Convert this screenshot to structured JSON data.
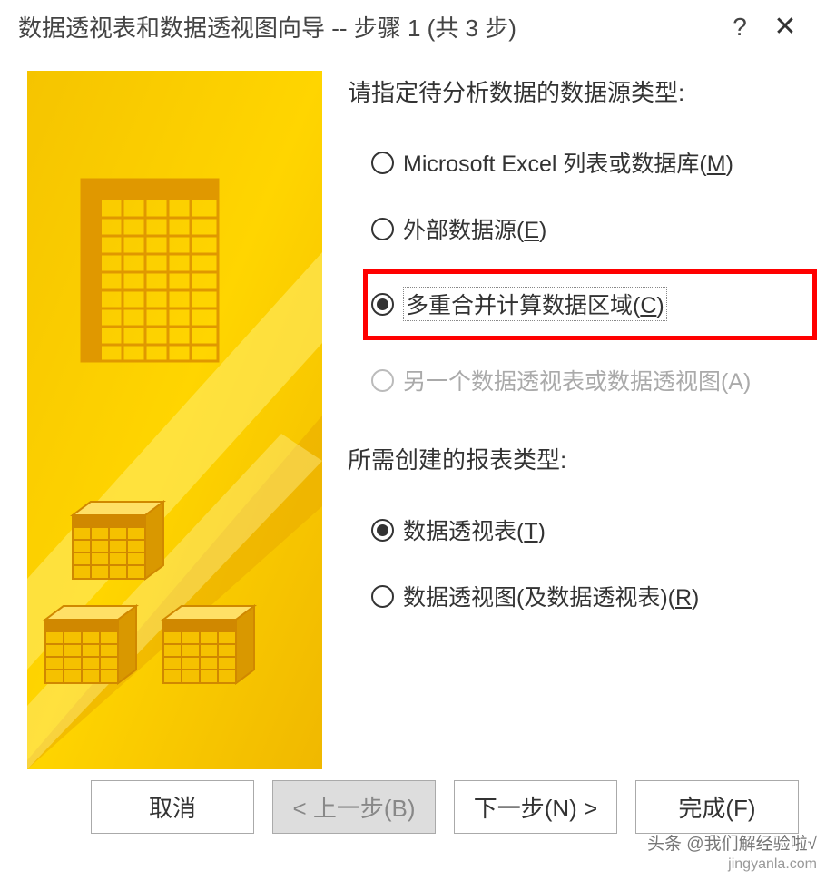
{
  "titlebar": {
    "title": "数据透视表和数据透视图向导 -- 步骤 1 (共 3 步)",
    "help": "?",
    "close": "✕"
  },
  "section1": {
    "label": "请指定待分析数据的数据源类型:",
    "options": [
      {
        "text": "Microsoft Excel 列表或数据库(",
        "accelerator": "M",
        "suffix": ")",
        "selected": false,
        "disabled": false
      },
      {
        "text": "外部数据源(",
        "accelerator": "E",
        "suffix": ")",
        "selected": false,
        "disabled": false
      },
      {
        "text": "多重合并计算数据区域(",
        "accelerator": "C",
        "suffix": ")",
        "selected": true,
        "disabled": false,
        "highlighted": true
      },
      {
        "text": "另一个数据透视表或数据透视图(A)",
        "accelerator": "",
        "suffix": "",
        "selected": false,
        "disabled": true
      }
    ]
  },
  "section2": {
    "label": "所需创建的报表类型:",
    "options": [
      {
        "text": "数据透视表(",
        "accelerator": "T",
        "suffix": ")",
        "selected": true,
        "disabled": false
      },
      {
        "text": "数据透视图(及数据透视表)(",
        "accelerator": "R",
        "suffix": ")",
        "selected": false,
        "disabled": false
      }
    ]
  },
  "buttons": {
    "cancel": "取消",
    "back": "< 上一步(B)",
    "next": "下一步(N) >",
    "finish": "完成(F)"
  },
  "watermark": {
    "line1": "头条 @我们解经验啦√",
    "line2": "jingyanla.com"
  },
  "graphic_colors": {
    "bg1": "#F2C000",
    "bg2": "#FFDD00",
    "bg3": "#E8A200",
    "frame": "#D99500"
  }
}
